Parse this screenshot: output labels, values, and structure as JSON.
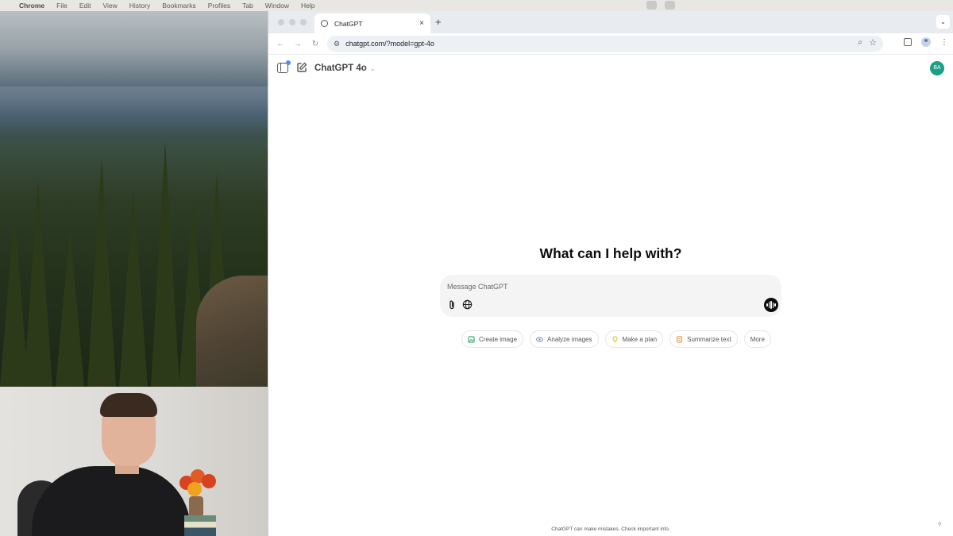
{
  "menubar": {
    "app_name": "Chrome",
    "items": [
      "File",
      "Edit",
      "View",
      "History",
      "Bookmarks",
      "Profiles",
      "Tab",
      "Window",
      "Help"
    ]
  },
  "browser": {
    "tab_title": "ChatGPT",
    "tab_close": "×",
    "new_tab": "+",
    "tab_menu": "⌄",
    "url": "chatgpt.com/?model=gpt-4o"
  },
  "page": {
    "model_label": "ChatGPT 4o",
    "avatar_initials": "BA",
    "headline": "What can I help with?",
    "composer_placeholder": "Message ChatGPT",
    "suggestions": [
      {
        "label": "Create image",
        "icon": "image-icon",
        "color": "#35a56b"
      },
      {
        "label": "Analyze images",
        "icon": "eye-icon",
        "color": "#6b8cc7"
      },
      {
        "label": "Make a plan",
        "icon": "lightbulb-icon",
        "color": "#e2c21f"
      },
      {
        "label": "Summarize text",
        "icon": "document-icon",
        "color": "#e08a3a"
      },
      {
        "label": "More",
        "icon": "",
        "color": ""
      }
    ],
    "disclaimer": "ChatGPT can make mistakes. Check important info.",
    "help": "?"
  },
  "colors": {
    "avatar": "#19a087",
    "notification_dot": "#4a8cf2"
  }
}
